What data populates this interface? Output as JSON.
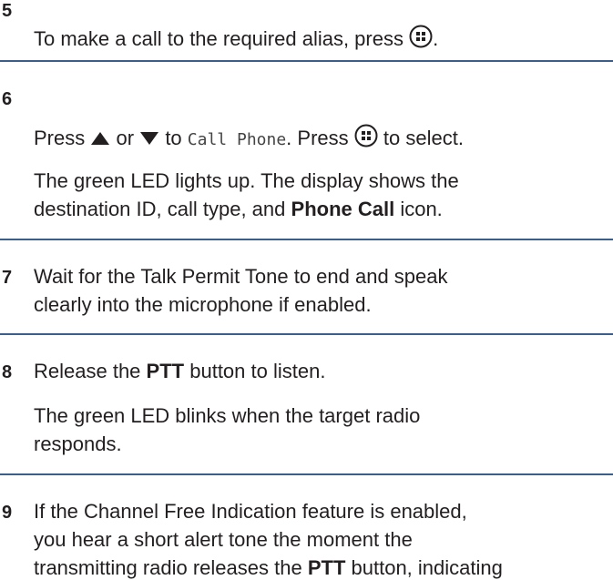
{
  "steps": [
    {
      "number": "5",
      "line1_before": "To make a call to the required alias, press",
      "line1_after": "."
    },
    {
      "number": "6",
      "press": "Press",
      "or": "or",
      "to": "to",
      "call_phone": "Call Phone",
      "press2": ". Press",
      "to_select": "to select.",
      "result_line1": "The green LED lights up. The display shows the",
      "result_line2_before": "destination ID, call type, and",
      "result_bold": "Phone Call",
      "result_line2_after": "icon."
    },
    {
      "number": "7",
      "line1": "Wait for the Talk Permit Tone to end and speak",
      "line2": "clearly into the microphone if enabled."
    },
    {
      "number": "8",
      "line1_before": "Release the",
      "line1_bold": "PTT",
      "line1_after": "button to listen.",
      "result_line1": "The green LED blinks when the target radio",
      "result_line2": "responds."
    },
    {
      "number": "9",
      "line1": "If the Channel Free Indication feature is enabled,",
      "line2": "you hear a short alert tone the moment the",
      "line3_before": "transmitting radio releases the",
      "line3_bold": "PTT",
      "line3_after": "button, indicating"
    }
  ],
  "icons": {
    "ok_button": "menu-ok-icon",
    "up_arrow": "up-arrow-icon",
    "down_arrow": "down-arrow-icon"
  },
  "colors": {
    "separator": "#3b5f8a",
    "text": "#231f20"
  }
}
